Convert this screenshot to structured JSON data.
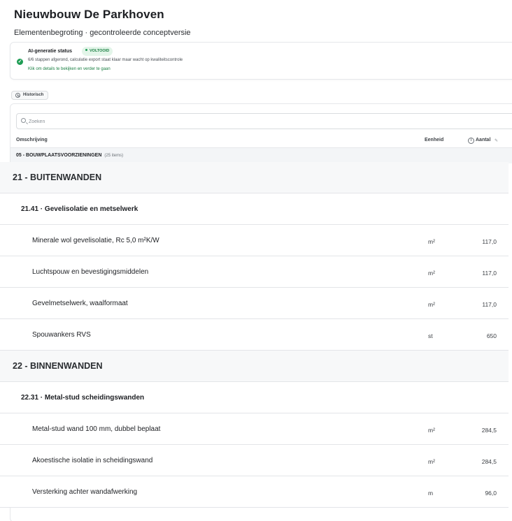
{
  "page": {
    "title": "Nieuwbouw De Parkhoven",
    "subtitle": "Elementenbegroting · gecontroleerde conceptversie"
  },
  "status": {
    "title": "AI-generatie status",
    "badge": "VOLTOOID",
    "detail": "6/6 stappen afgerond, calculatie export staat klaar maar wacht op kwaliteitscontrole",
    "link": "Klik om details te bekijken en verder te gaan",
    "accent_color": "#1f9d55"
  },
  "history_button": {
    "label": "Historisch",
    "icon": "clock-icon"
  },
  "search": {
    "placeholder": "Zoeken",
    "value": "",
    "icon": "search-icon"
  },
  "columns": {
    "omschrijving": "Omschrijving",
    "eenheid": "Eenheid",
    "aantal": "Aantal"
  },
  "group": {
    "label": "05 - BOUWPLAATSVOORZIENINGEN",
    "count": "(25 items)"
  },
  "rows": [
    {
      "type": "section",
      "label": "21 - BUITENWANDEN",
      "unit": "",
      "qty": ""
    },
    {
      "type": "subsection",
      "label": "21.41 · Gevelisolatie en metselwerk",
      "unit": "",
      "qty": ""
    },
    {
      "type": "item",
      "label": "Minerale wol gevelisolatie, Rc 5,0 m²K/W",
      "unit": "m²",
      "qty": "117,0"
    },
    {
      "type": "item",
      "label": "Luchtspouw en bevestigingsmiddelen",
      "unit": "m²",
      "qty": "117,0"
    },
    {
      "type": "item",
      "label": "Gevelmetselwerk, waalformaat",
      "unit": "m²",
      "qty": "117,0"
    },
    {
      "type": "item",
      "label": "Spouwankers RVS",
      "unit": "st",
      "qty": "650"
    },
    {
      "type": "section",
      "label": "22 - BINNENWANDEN",
      "unit": "",
      "qty": ""
    },
    {
      "type": "subsection",
      "label": "22.31 · Metal-stud scheidingswanden",
      "unit": "",
      "qty": ""
    },
    {
      "type": "item",
      "label": "Metal-stud wand 100 mm, dubbel beplaat",
      "unit": "m²",
      "qty": "284,5"
    },
    {
      "type": "item",
      "label": "Akoestische isolatie in scheidingswand",
      "unit": "m²",
      "qty": "284,5"
    },
    {
      "type": "item",
      "label": "Versterking achter wandafwerking",
      "unit": "m",
      "qty": "96,0"
    }
  ]
}
